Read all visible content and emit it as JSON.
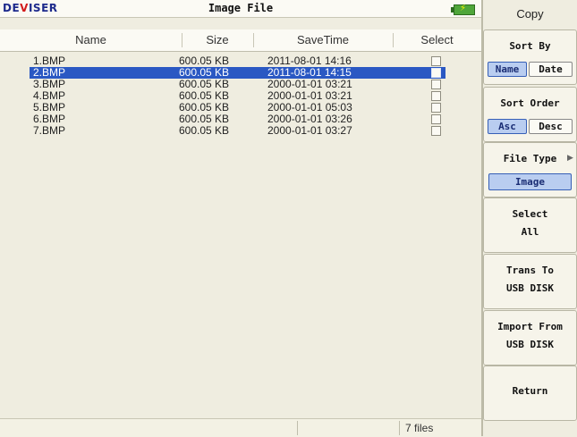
{
  "header": {
    "brand_pre": "DE",
    "brand_v": "V",
    "brand_post": "ISER",
    "title": "Image File",
    "battery_icon": "battery-charging-icon",
    "battery_color": "#4fa63a"
  },
  "table": {
    "columns": [
      "Name",
      "Size",
      "SaveTime",
      "Select"
    ],
    "rows": [
      {
        "name": "1.BMP",
        "size": "600.05 KB",
        "time": "2011-08-01 14:16",
        "selected": false
      },
      {
        "name": "2.BMP",
        "size": "600.05 KB",
        "time": "2011-08-01 14:15",
        "selected": true
      },
      {
        "name": "3.BMP",
        "size": "600.05 KB",
        "time": "2000-01-01 03:21",
        "selected": false
      },
      {
        "name": "4.BMP",
        "size": "600.05 KB",
        "time": "2000-01-01 03:21",
        "selected": false
      },
      {
        "name": "5.BMP",
        "size": "600.05 KB",
        "time": "2000-01-01 05:03",
        "selected": false
      },
      {
        "name": "6.BMP",
        "size": "600.05 KB",
        "time": "2000-01-01 03:26",
        "selected": false
      },
      {
        "name": "7.BMP",
        "size": "600.05 KB",
        "time": "2000-01-01 03:27",
        "selected": false
      }
    ],
    "highlight_color": "#2a58c3"
  },
  "status": {
    "file_count": "7 files"
  },
  "menu": {
    "title": "Copy",
    "sort_by": {
      "label": "Sort By",
      "options": [
        "Name",
        "Date"
      ],
      "active": "Name"
    },
    "sort_order": {
      "label": "Sort Order",
      "options": [
        "Asc",
        "Desc"
      ],
      "active": "Asc"
    },
    "file_type": {
      "label": "File Type",
      "value": "Image",
      "arrow_icon": "triangle-right-icon"
    },
    "select_all": {
      "line1": "Select",
      "line2": "All"
    },
    "trans_to": {
      "line1": "Trans To",
      "line2": "USB DISK"
    },
    "import_from": {
      "line1": "Import From",
      "line2": "USB DISK"
    },
    "return": {
      "label": "Return"
    }
  }
}
